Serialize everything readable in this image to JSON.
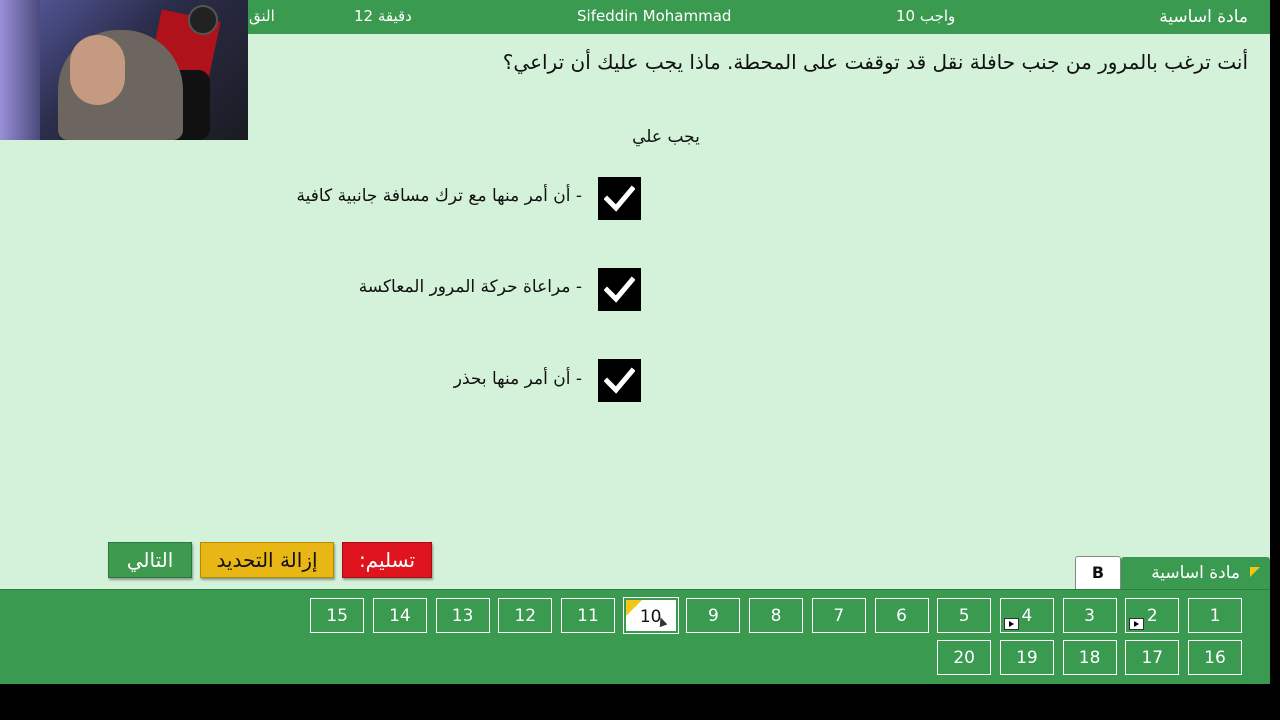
{
  "header": {
    "category": "مادة اساسية",
    "homework": "واجب  10",
    "student": "Sifeddin Mohammad",
    "time": "12 دقيقة",
    "points": "النق"
  },
  "question": {
    "text": "أنت ترغب بالمرور من جنب حافلة نقل قد توقفت على المحطة. ماذا يجب عليك أن تراعي؟",
    "subtitle": "يجب علي",
    "options": [
      {
        "text": "- أن أمر منها مع ترك مسافة جانبية كافية",
        "checked": true
      },
      {
        "text": "- مراعاة حركة المرور المعاكسة",
        "checked": true
      },
      {
        "text": "- أن أمر منها بحذر",
        "checked": true
      }
    ]
  },
  "buttons": {
    "next": "التالي",
    "clear": "إزالة التحديد",
    "submit": "تسليم:"
  },
  "tabs": {
    "license": "B",
    "category": "مادة اساسية"
  },
  "navigation": {
    "current": 10,
    "row1": [
      1,
      2,
      3,
      4,
      5,
      6,
      7,
      8,
      9,
      10,
      11,
      12,
      13,
      14,
      15
    ],
    "row2": [
      16,
      17,
      18,
      19,
      20
    ],
    "media_questions": [
      2,
      4
    ],
    "flagged": [
      10
    ]
  },
  "colors": {
    "green": "#3a9a4f",
    "background": "#d4f1d9",
    "next": "#3d9a4e",
    "clear": "#e8b716",
    "submit": "#e0141e"
  }
}
